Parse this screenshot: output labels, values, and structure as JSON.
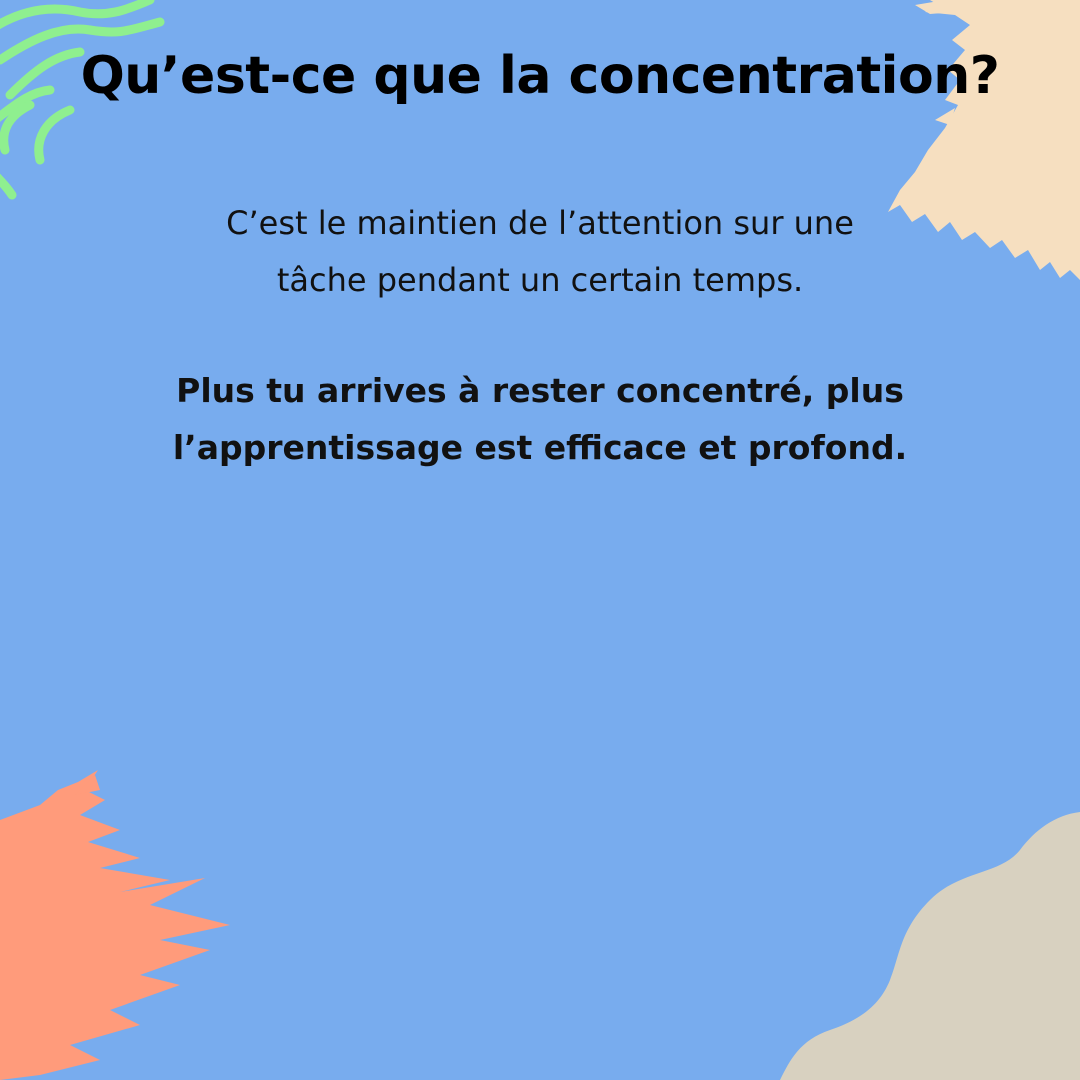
{
  "background_color": "#78acee",
  "text_color": "#000000",
  "decorations": [
    {
      "name": "green-wave-lines",
      "color": "#8fef8f"
    },
    {
      "name": "beige-brush-stroke",
      "color": "#f6dfc0"
    },
    {
      "name": "salmon-brush-stroke",
      "color": "#ff9b7b"
    },
    {
      "name": "grey-blob",
      "color": "#d8d1c0"
    }
  ],
  "title": "Qu’est-ce que la concentration?",
  "definition": {
    "lines": [
      "C’est le maintien de l’attention sur une",
      "tâche pendant un certain temps."
    ]
  },
  "emphasis": {
    "lines": [
      "Plus tu arrives à rester concentré, plus",
      "l’apprentissage est efficace et profond."
    ]
  }
}
